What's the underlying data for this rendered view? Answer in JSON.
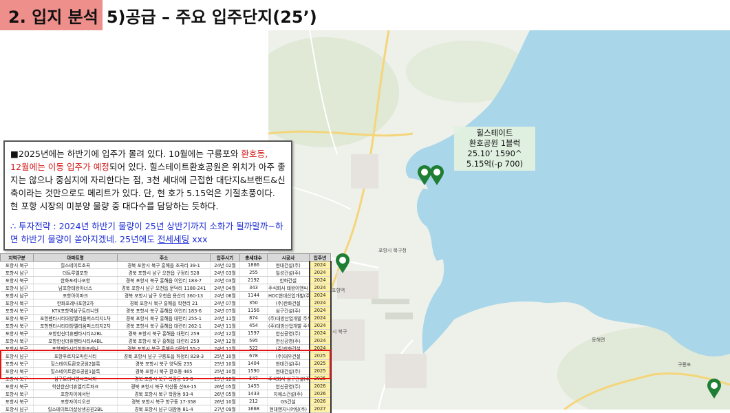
{
  "title": {
    "section": "2. 입지 분석",
    "subtitle": "5)공급 – 주요 입주단지(25’)"
  },
  "note": {
    "line_a": "■2025년에는 하반기에 입주가 몰려 있다. 10월에는 구룡포와 ",
    "red_1": "환호동,",
    "red_2": "12월에는 이동 입주가 예정",
    "line_b": "되어 있다. 힐스테이트환호공원은 위치가 아주 좋지는 않으나 중심지에 자리한다는 점, 3천 세대에 근접한 대단지&브랜드&신축이라는 것만으로도 메리트가 있다. 단, 현 호가 5.15억은 기절초풍이다. 현 포항 시장의 미분양 물량 중 대다수를 담당하는 듯하다.",
    "strategy_a": "∴ 투자전략 : 2024년 하반기 물량이 25년 상반기까지 소화가 될까말까~하면 하반기 물량이 쏟아지겠네. 25년에도 ",
    "strategy_b": "전세세팅",
    "strategy_c": " xxx"
  },
  "callout": {
    "line1": "힐스테이트",
    "line2": "환호공원 1블럭",
    "line3": "25.10’ 1590^",
    "line4": "5.15억(-p 700)"
  },
  "map_labels": {
    "station": "포항역",
    "bukgu": "포항시 북구청",
    "port": "포항시 북구",
    "guryongpo": "구룡포",
    "donghae": "동해면"
  },
  "table": {
    "headers": [
      "지역구분",
      "아파트명",
      "주소",
      "입주시기",
      "총세대수",
      "시공사",
      "입주년"
    ],
    "rows": [
      [
        "포항시 북구",
        "힐스테이트초곡",
        "경북 포항시 북구 흥해읍 초곡리 39-1",
        "24년 02월",
        "1866",
        "현대건설(주)",
        "2024"
      ],
      [
        "포항시 남구",
        "더트루엘포항",
        "경북 포항시 남구 오천읍 구정리 528",
        "24년 03월",
        "255",
        "일성건설(주)",
        "2024"
      ],
      [
        "포항시 북구",
        "한화포레나포항",
        "경북 포항시 북구 흥해읍 이인리 183-7",
        "24년 03월",
        "2192",
        "한화건설",
        "2024"
      ],
      [
        "포항시 남구",
        "남포항태왕아너스",
        "경북 포항시 남구 오천읍 문덕리 1188-241",
        "24년 04월",
        "343",
        "주식회사 태왕이앤씨",
        "2024"
      ],
      [
        "포항시 남구",
        "포항아이파크",
        "경북 포항시 남구 오천읍 용산리 360-13",
        "24년 06월",
        "1144",
        "HDC현대산업개발(주)",
        "2024"
      ],
      [
        "포항시 북구",
        "한화포레나포항2차",
        "경북 포항시 북구 흥해읍 학천리 21",
        "24년 07월",
        "350",
        "(주)한화건설",
        "2024"
      ],
      [
        "포항시 북구",
        "KTX포항역삼구트리니엔",
        "경북 포항시 북구 흥해읍 이인리 183-6",
        "24년 07월",
        "1156",
        "삼구건설(주)",
        "2024"
      ],
      [
        "포항시 북구",
        "포항펜타시티대방엘리움퍼스티지1차",
        "경북 포항시 북구 흥해읍 대련리 255-1",
        "24년 11월",
        "874",
        "(주)대방산업개발 주식회",
        "2024"
      ],
      [
        "포항시 북구",
        "포항펜타시티대방엘리움퍼스티지2차",
        "경북 포항시 북구 흥해읍 대련리 262-1",
        "24년 11월",
        "454",
        "(주)대방산업개발 주식회",
        "2024"
      ],
      [
        "포항시 북구",
        "포항한신더휴펜타시티A2BL",
        "경북 포항시 북구 흥해읍 대련리 259",
        "24년 12월",
        "1597",
        "한신공영(주)",
        "2024"
      ],
      [
        "포항시 북구",
        "포항한신더휴펜타시티A4BL",
        "경북 포항시 북구 흥해읍 대련리 259",
        "24년 12월",
        "595",
        "한신공영(주)",
        "2024"
      ],
      [
        "포항시 북구",
        "포항펜타시티한화포레나",
        "경북 포항시 북구 흥해읍 대련리 55-2",
        "24년 12월",
        "522",
        "(주)한화건설",
        "2024"
      ],
      [
        "포항시 남구",
        "포항푸르지오마린시티",
        "경북 포항시 남구 구룡포읍 하정리 828-3",
        "25년 10월",
        "678",
        "(주)대우건설",
        "2025"
      ],
      [
        "포항시 북구",
        "힐스테이트환호공원2블록",
        "경북 포항시 북구 양덕동 235",
        "25년 10월",
        "1404",
        "현대건설(주)",
        "2025"
      ],
      [
        "포항시 북구",
        "힐스테이트환호공원1블록",
        "경북 포항시 북구 환호동 465",
        "25년 10월",
        "1590",
        "현대건설(주)",
        "2025"
      ],
      [
        "포항시 북구",
        "삼구트리니엔시그니처",
        "경북 포항시 북구 학잠동 19-8",
        "25년 12월",
        "547",
        "주식회사 삼구건설(주)",
        "2025"
      ],
      [
        "포항시 북구",
        "학산한신더휴엘리트파크",
        "경북 포항시 북구 학산동 산63-15",
        "26년 05월",
        "1455",
        "한신공영(주)",
        "2026"
      ],
      [
        "포항시 북구",
        "포항자이애서턴",
        "경북 포항시 북구 학잠동 93-4",
        "26년 05월",
        "1433",
        "지에스건설(주)",
        "2026"
      ],
      [
        "포항시 북구",
        "포항자이디오션",
        "경북 포항시 북구 항구동 17-358",
        "26년 10월",
        "212",
        "GS건설",
        "2026"
      ],
      [
        "포항시 남구",
        "힐스테이트더샵상생공원2BL",
        "경북 포항시 남구 대잠동 81-4",
        "27년 09월",
        "1668",
        "현대엔지니어링(주)",
        "2027"
      ]
    ]
  },
  "colors": {
    "title_highlight": "#ef8f8c",
    "note_red": "#d21a1a",
    "note_blue": "#1f2fd6",
    "highlight_box": "#e81212",
    "year_column": "#fff2a8",
    "sea": "#a9d6e8",
    "land": "#eef0ea",
    "pin": "#1e7e34"
  }
}
